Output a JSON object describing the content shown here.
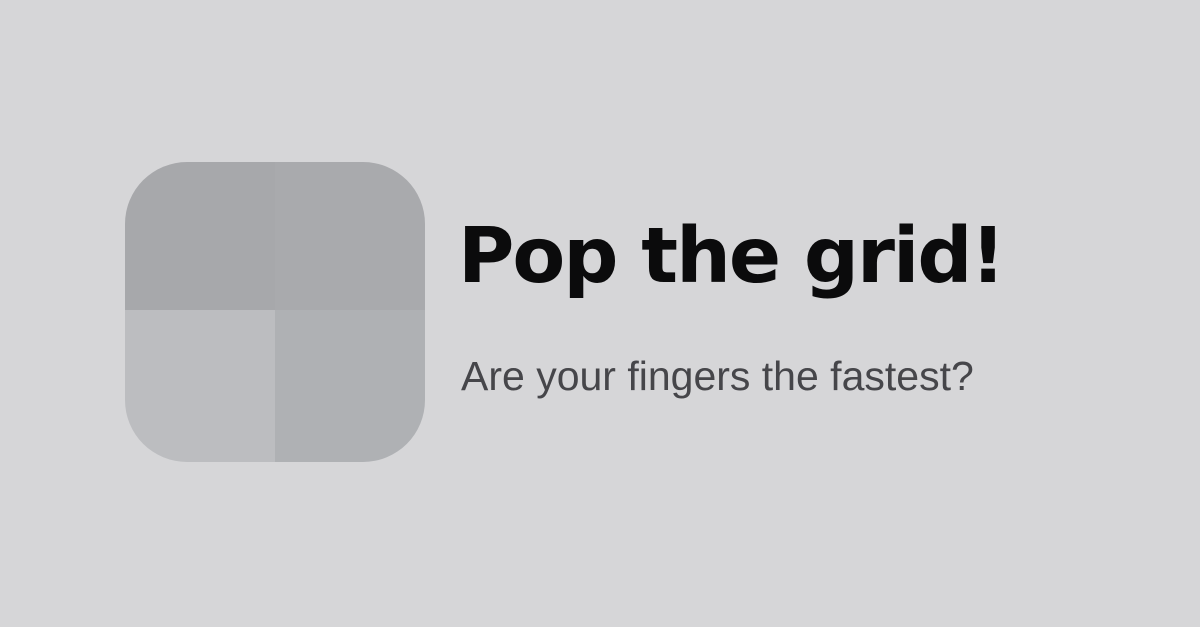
{
  "brand": {
    "title": "Pop the grid!",
    "tagline": "Are your fingers the fastest?"
  },
  "logo": {
    "icon": "grid-2x2-icon",
    "tiles": [
      {
        "position": "top-left",
        "color": "#a7a8ab"
      },
      {
        "position": "top-right",
        "color": "#a9aaad"
      },
      {
        "position": "bottom-left",
        "color": "#bcbdc0"
      },
      {
        "position": "bottom-right",
        "color": "#afb1b4"
      }
    ]
  },
  "colors": {
    "background": "#d6d6d8",
    "title": "#0b0b0c",
    "tagline": "#46464a"
  }
}
